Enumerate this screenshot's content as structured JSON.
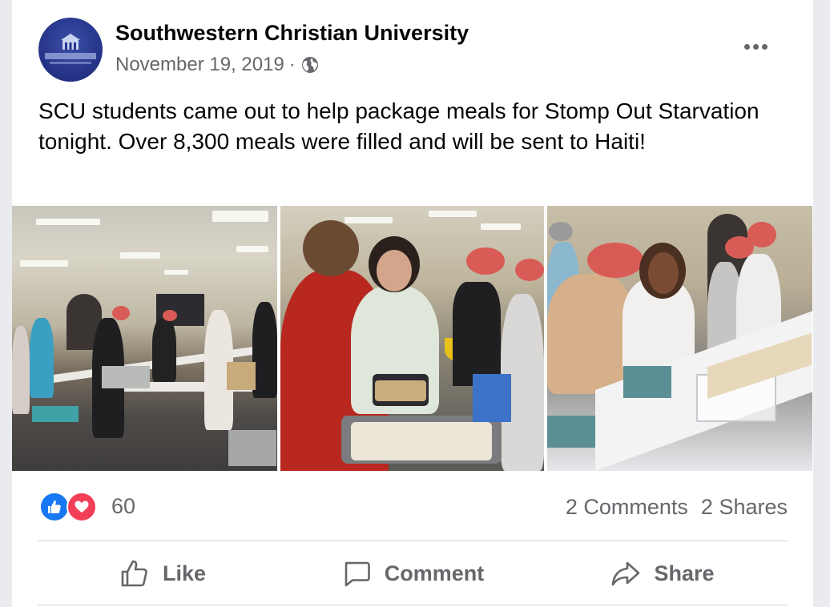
{
  "post": {
    "page_name": "Southwestern Christian University",
    "date": "November 19, 2019",
    "separator": "·",
    "privacy_icon": "globe-icon",
    "text": "SCU students came out to help package meals for Stomp Out Starvation tonight. Over 8,300 meals were filled and will be sent to Haiti!"
  },
  "stats": {
    "reaction_icons": [
      "like-icon",
      "love-icon"
    ],
    "reaction_count": "60",
    "comments": "2 Comments",
    "shares": "2 Shares"
  },
  "actions": {
    "like_label": "Like",
    "comment_label": "Comment",
    "share_label": "Share"
  },
  "colors": {
    "page_bg": "#e9ebee",
    "card_bg": "#ffffff",
    "secondary_text": "#65676b",
    "primary_text": "#050505",
    "like_blue": "#1877f2",
    "love_red": "#f33e58"
  }
}
